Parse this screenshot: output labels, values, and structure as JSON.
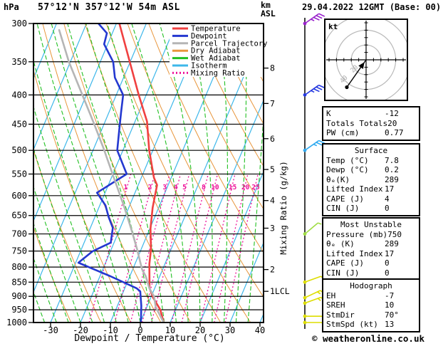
{
  "header": {
    "pressure_unit": "hPa",
    "station_title": "57°12'N 357°12'W 54m ASL",
    "altitude_unit_line1": "km",
    "altitude_unit_line2": "ASL",
    "datetime_title": "29.04.2022 12GMT (Base: 00)"
  },
  "legend": {
    "items": [
      {
        "label": "Temperature",
        "color": "#f04040",
        "dash": ""
      },
      {
        "label": "Dewpoint",
        "color": "#2438d0",
        "dash": ""
      },
      {
        "label": "Parcel Trajectory",
        "color": "#b5b5b5",
        "dash": ""
      },
      {
        "label": "Dry Adiabat",
        "color": "#e8963c",
        "dash": ""
      },
      {
        "label": "Wet Adiabat",
        "color": "#22c022",
        "dash": ""
      },
      {
        "label": "Isotherm",
        "color": "#3db7ea",
        "dash": ""
      },
      {
        "label": "Mixing Ratio",
        "color": "#ee1199",
        "dash": "2,3"
      }
    ]
  },
  "chart_data": {
    "type": "line",
    "variant": "skew-t-log-p-sounding",
    "title": "57°12'N 357°12'W 54m ASL",
    "xlabel": "Dewpoint / Temperature (°C)",
    "ylabel": "hPa",
    "x_axis": {
      "ticks": [
        -30,
        -20,
        -10,
        0,
        10,
        20,
        30,
        40
      ],
      "min": -35.5,
      "max": 41.2
    },
    "y_axis": {
      "scale": "log",
      "top": 300,
      "bottom": 1000,
      "ticks": [
        300,
        350,
        400,
        450,
        500,
        550,
        600,
        650,
        700,
        750,
        800,
        850,
        900,
        950,
        1000
      ]
    },
    "altitude_axis": {
      "label_line1": "km",
      "label_line2": "ASL",
      "ticks": [
        {
          "label": "8",
          "p": 359
        },
        {
          "label": "7",
          "p": 414
        },
        {
          "label": "6",
          "p": 477
        },
        {
          "label": "5",
          "p": 540
        },
        {
          "label": "4",
          "p": 612
        },
        {
          "label": "3",
          "p": 684
        },
        {
          "label": "2",
          "p": 808
        },
        {
          "label": "1LCL",
          "p": 882
        }
      ]
    },
    "mixing_ratio": {
      "axis_label": "Mixing Ratio (g/kg)",
      "values": [
        1,
        2,
        3,
        4,
        5,
        8,
        10,
        15,
        20,
        25
      ],
      "label_pressure": 585,
      "top_pressure": 550
    },
    "background": {
      "isotherm_step_c": 10,
      "dry_adiabat_step_k": 10,
      "wet_adiabat_step_c": 4
    },
    "series": [
      {
        "name": "Temperature",
        "color": "#f04040",
        "width": 2.6,
        "points_p_t": [
          [
            1000,
            7.8
          ],
          [
            950,
            4.9
          ],
          [
            905,
            0.8
          ],
          [
            870,
            -1.8
          ],
          [
            850,
            -2.6
          ],
          [
            790,
            -5.2
          ],
          [
            745,
            -6.7
          ],
          [
            685,
            -9.8
          ],
          [
            630,
            -12.0
          ],
          [
            575,
            -13.7
          ],
          [
            558,
            -15.8
          ],
          [
            500,
            -21.2
          ],
          [
            445,
            -26.0
          ],
          [
            400,
            -32.5
          ],
          [
            300,
            -49.0
          ]
        ]
      },
      {
        "name": "Dewpoint",
        "color": "#2438d0",
        "width": 2.6,
        "points_p_t": [
          [
            1000,
            0.2
          ],
          [
            935,
            -2.0
          ],
          [
            882,
            -4.4
          ],
          [
            871,
            -6.1
          ],
          [
            830,
            -16.5
          ],
          [
            786,
            -29.1
          ],
          [
            751,
            -26.0
          ],
          [
            725,
            -21.1
          ],
          [
            683,
            -22.5
          ],
          [
            655,
            -25.3
          ],
          [
            624,
            -28.1
          ],
          [
            593,
            -32.7
          ],
          [
            550,
            -25.4
          ],
          [
            538,
            -26.9
          ],
          [
            500,
            -31.9
          ],
          [
            462,
            -34.0
          ],
          [
            430,
            -35.9
          ],
          [
            400,
            -37.7
          ],
          [
            373,
            -42.9
          ],
          [
            350,
            -45.7
          ],
          [
            326,
            -51.2
          ],
          [
            312,
            -51.8
          ],
          [
            300,
            -56.0
          ]
        ]
      },
      {
        "name": "Parcel Trajectory",
        "color": "#b5b5b5",
        "width": 2.6,
        "points_p_t": [
          [
            1000,
            7.8
          ],
          [
            940,
            3.0
          ],
          [
            900,
            0.9
          ],
          [
            871,
            -1.8
          ],
          [
            830,
            -4.7
          ],
          [
            807,
            -6.9
          ],
          [
            744,
            -11.4
          ],
          [
            686,
            -16.2
          ],
          [
            627,
            -21.7
          ],
          [
            558,
            -29.2
          ],
          [
            494,
            -37.0
          ],
          [
            449,
            -43.4
          ],
          [
            395,
            -52.2
          ],
          [
            350,
            -60.5
          ],
          [
            308,
            -68.2
          ]
        ]
      }
    ],
    "wind_barbs": [
      {
        "p": 300,
        "color": "#9922cc",
        "dir_deg": 55,
        "speed_kt": 35
      },
      {
        "p": 400,
        "color": "#2438e0",
        "dir_deg": 55,
        "speed_kt": 35
      },
      {
        "p": 500,
        "color": "#30aaf0",
        "dir_deg": 55,
        "speed_kt": 25
      },
      {
        "p": 700,
        "color": "#a0dd44",
        "dir_deg": 50,
        "speed_kt": 5
      },
      {
        "p": 850,
        "color": "#dddd00",
        "dir_deg": 70,
        "speed_kt": 10
      },
      {
        "p": 905,
        "color": "#dddd00",
        "dir_deg": 65,
        "speed_kt": 15
      },
      {
        "p": 925,
        "color": "#dddd00",
        "dir_deg": 70,
        "speed_kt": 15
      },
      {
        "p": 975,
        "color": "#dddd00",
        "dir_deg": 90,
        "speed_kt": 10
      },
      {
        "p": 1000,
        "color": "#dddd00",
        "dir_deg": 90,
        "speed_kt": 10
      }
    ]
  },
  "hodograph": {
    "unit_label": "kt",
    "ring_step_kt": 20,
    "ring_labels": [
      "20",
      "40"
    ],
    "trace_u_v_kt": [
      [
        -26,
        -37
      ],
      [
        0,
        0
      ]
    ]
  },
  "panels": [
    {
      "name": "indices",
      "title": "",
      "rows": [
        [
          "K",
          "-12"
        ],
        [
          "Totals Totals",
          "20"
        ],
        [
          "PW (cm)",
          "0.77"
        ]
      ]
    },
    {
      "name": "surface",
      "title": "Surface",
      "rows": [
        [
          "Temp (°C)",
          "7.8"
        ],
        [
          "Dewp (°C)",
          "0.2"
        ],
        [
          "θₑ(K)",
          "289"
        ],
        [
          "Lifted Index",
          "17"
        ],
        [
          "CAPE (J)",
          "4"
        ],
        [
          "CIN (J)",
          "0"
        ]
      ]
    },
    {
      "name": "most-unstable",
      "title": "Most Unstable",
      "rows": [
        [
          "Pressure (mb)",
          "750"
        ],
        [
          "θₑ (K)",
          "289"
        ],
        [
          "Lifted Index",
          "17"
        ],
        [
          "CAPE (J)",
          "0"
        ],
        [
          "CIN (J)",
          "0"
        ]
      ]
    },
    {
      "name": "hodograph",
      "title": "Hodograph",
      "rows": [
        [
          "EH",
          "-7"
        ],
        [
          "SREH",
          "10"
        ],
        [
          "StmDir",
          "70°"
        ],
        [
          "StmSpd (kt)",
          "13"
        ]
      ]
    }
  ],
  "footer": {
    "copyright": "© weatheronline.co.uk"
  },
  "colors": {
    "isobar": "#000000",
    "isotherm": "#3db7ea",
    "dry_adiabat": "#e8963c",
    "wet_adiabat": "#22c022",
    "mixing_ratio": "#ee1199",
    "axis": "#000000",
    "hodograph_ring": "#b8b8b8"
  }
}
